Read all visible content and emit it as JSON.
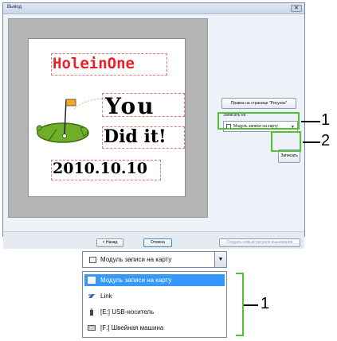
{
  "window": {
    "title": "Вывод",
    "close_symbol": "✕"
  },
  "picture": {
    "title": "HoleinOne",
    "line1": "You",
    "line2": "Did  it!",
    "date": "2010.10.10"
  },
  "panel": {
    "edit_button": "Правка на странице \"Рисунок\"",
    "write_to_label": "Записать на",
    "device_selected": "Модуль записи на карту",
    "write_button": "Записать"
  },
  "footer": {
    "back_button": "< Назад",
    "cancel_button": "Отмена",
    "new_button": "Создать новый рисунок вышивания"
  },
  "callouts": {
    "one": "1",
    "two": "2",
    "list_one": "1"
  },
  "dropdown": {
    "selected": "Модуль записи на карту",
    "items": [
      {
        "label": "Модуль записи на карту",
        "icon": "card-module-icon"
      },
      {
        "label": "Link",
        "icon": "link-icon"
      },
      {
        "label": "[E:] USB-носитель",
        "icon": "usb-icon"
      },
      {
        "label": "[F:] Швейная машина",
        "icon": "sewing-machine-icon"
      }
    ]
  },
  "colors": {
    "highlight": "#52c233",
    "title_red": "#e8202a",
    "selection": "#3399ff"
  }
}
